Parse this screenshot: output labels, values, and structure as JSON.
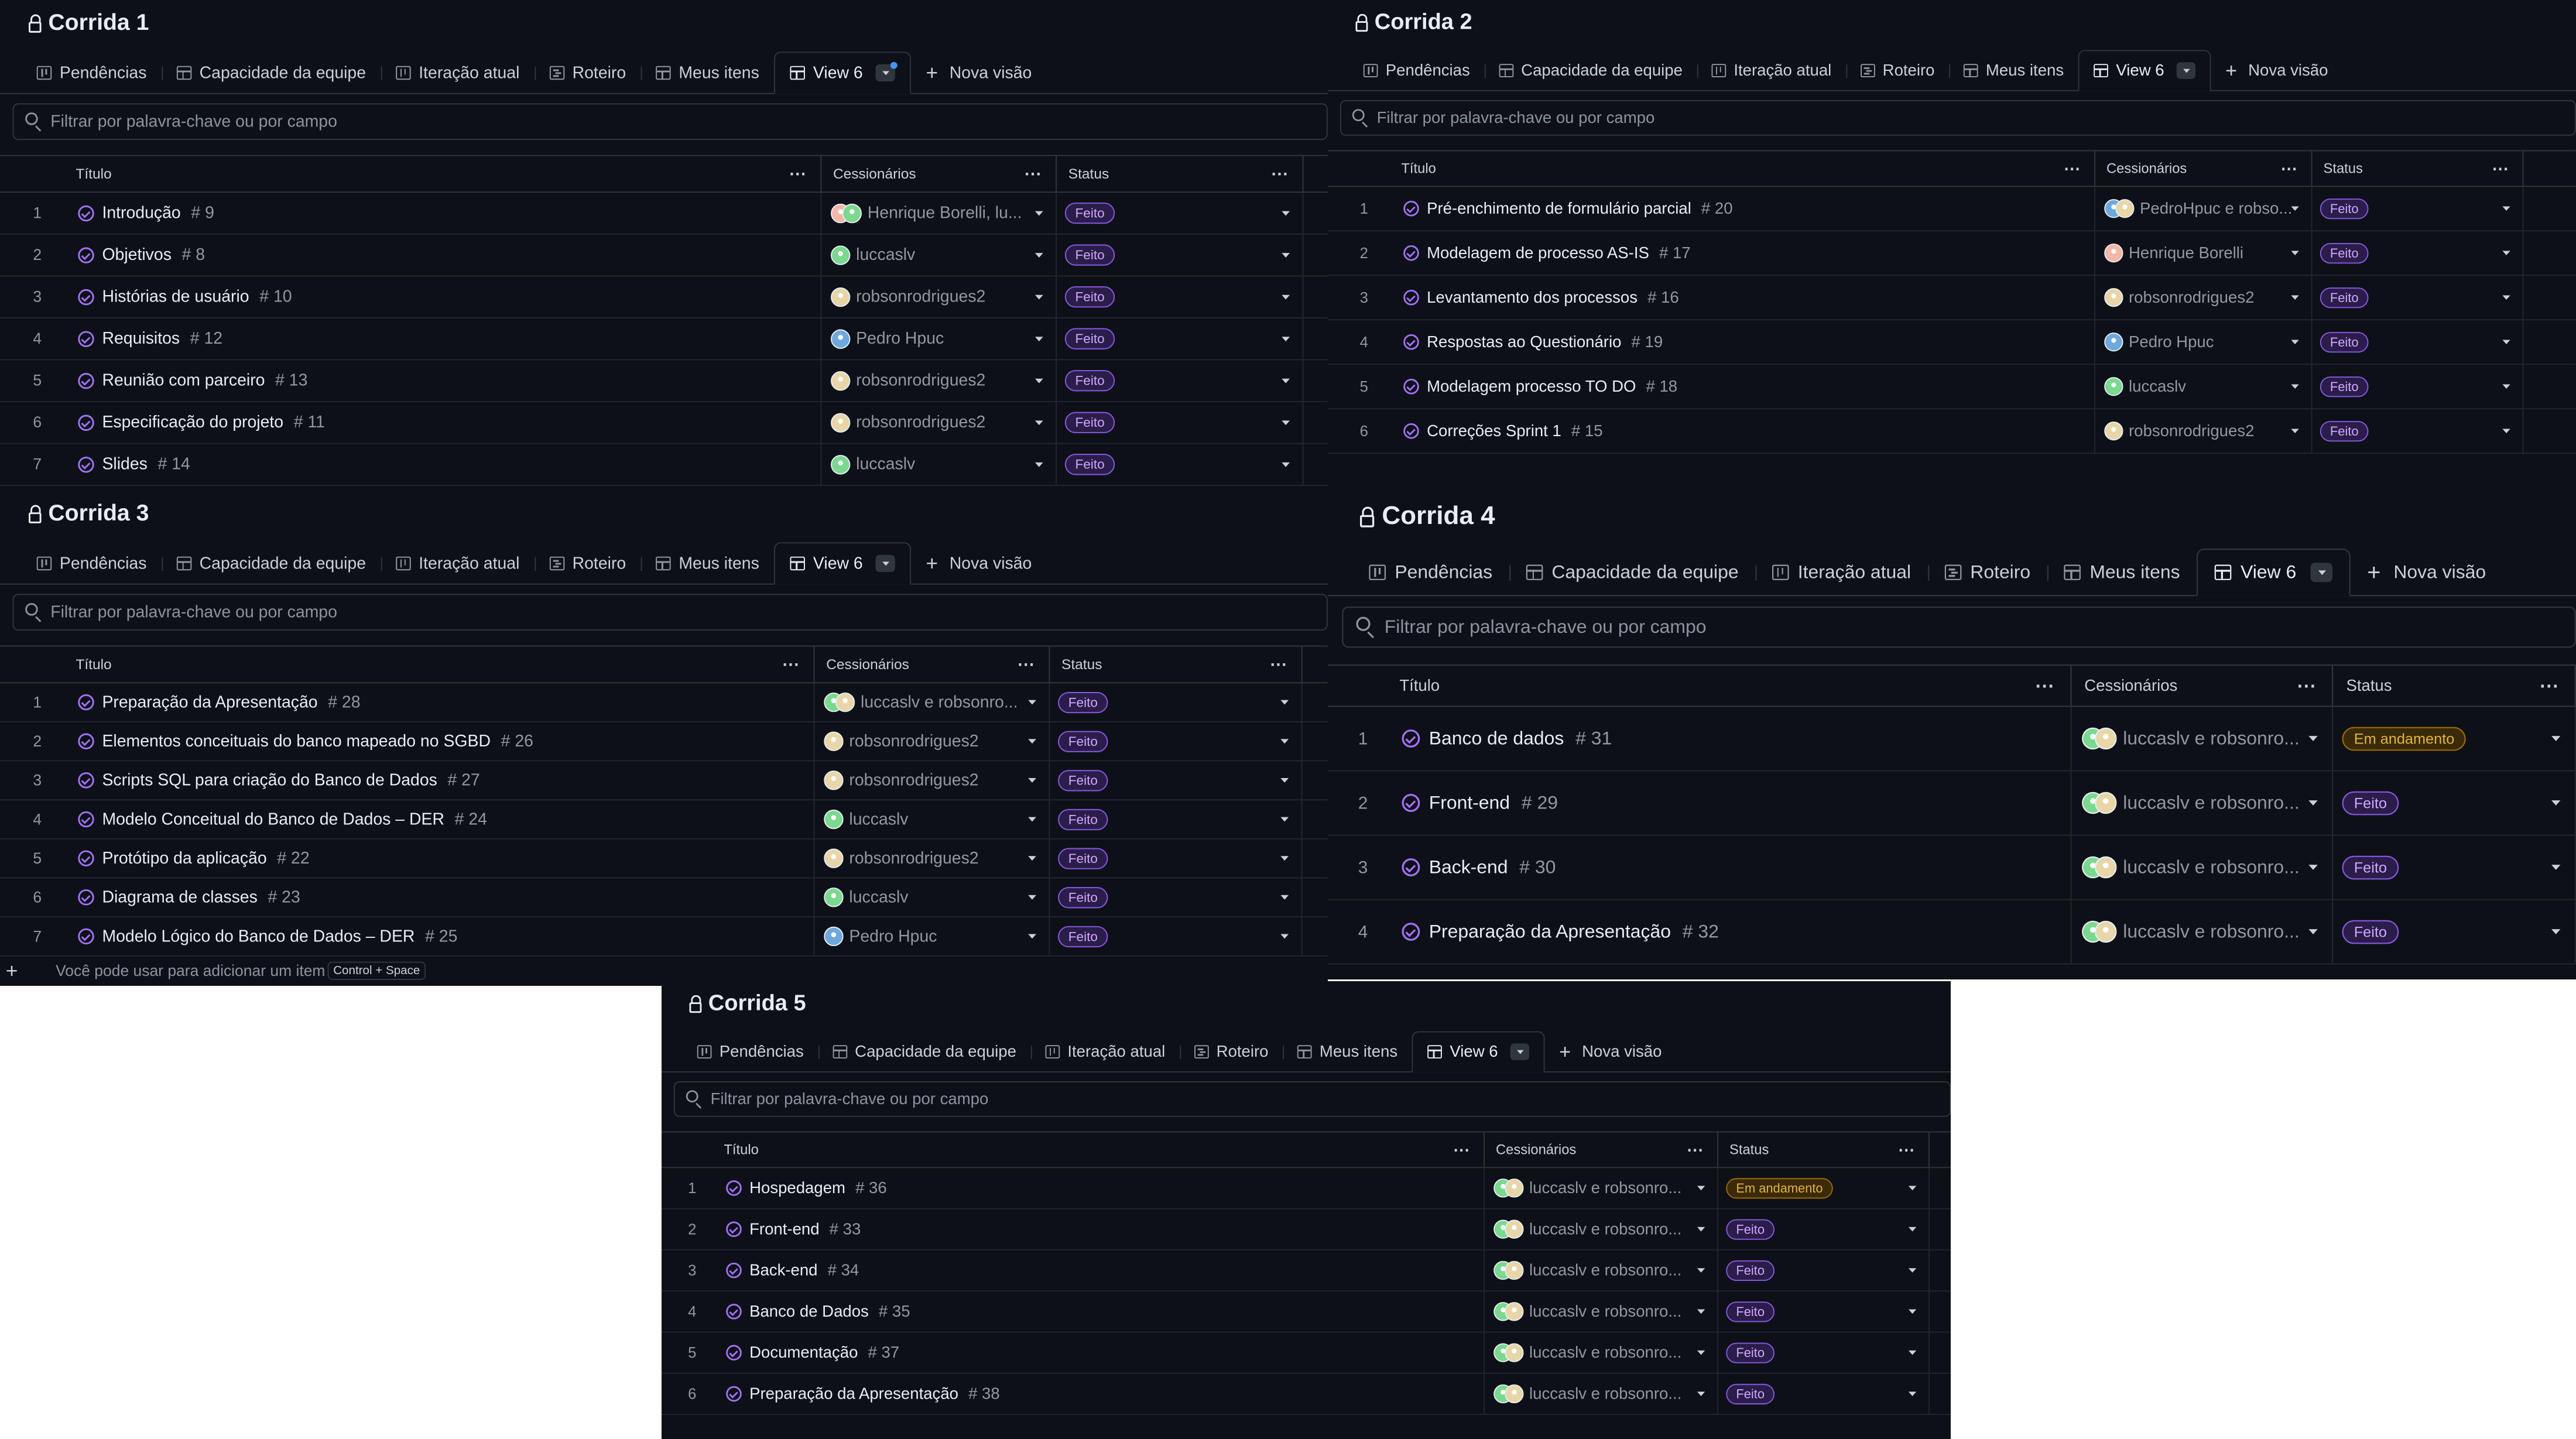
{
  "tabs": [
    {
      "label": "Pendências",
      "icon": "board-icon"
    },
    {
      "label": "Capacidade da equipe",
      "icon": "table-icon"
    },
    {
      "label": "Iteração atual",
      "icon": "board-icon"
    },
    {
      "label": "Roteiro",
      "icon": "roadmap-icon"
    },
    {
      "label": "Meus itens",
      "icon": "table-icon"
    },
    {
      "label": "View 6",
      "icon": "table-icon",
      "active": true
    }
  ],
  "new_view_label": "Nova visão",
  "filter_placeholder": "Filtrar por palavra-chave ou por campo",
  "columns": {
    "title": "Título",
    "assignees": "Cessionários",
    "status": "Status"
  },
  "add_item": {
    "text": "Você pode usar para adicionar um item",
    "shortcut": "Control + Space"
  },
  "colors": {
    "done_accent": "#a371f7",
    "progress_accent": "#e3b341",
    "background": "#0d1117"
  },
  "panels": [
    {
      "title": "Corrida 1",
      "rows": [
        {
          "n": "1",
          "title": "Introdução",
          "issue": "# 9",
          "assignee": "Henrique Borelli, lu...",
          "status": "Feito"
        },
        {
          "n": "2",
          "title": "Objetivos",
          "issue": "# 8",
          "assignee": "luccaslv",
          "status": "Feito"
        },
        {
          "n": "3",
          "title": "Histórias de usuário",
          "issue": "# 10",
          "assignee": "robsonrodrigues2",
          "status": "Feito"
        },
        {
          "n": "4",
          "title": "Requisitos",
          "issue": "# 12",
          "assignee": "Pedro Hpuc",
          "status": "Feito"
        },
        {
          "n": "5",
          "title": "Reunião com parceiro",
          "issue": "# 13",
          "assignee": "robsonrodrigues2",
          "status": "Feito"
        },
        {
          "n": "6",
          "title": "Especificação do projeto",
          "issue": "# 11",
          "assignee": "robsonrodrigues2",
          "status": "Feito"
        },
        {
          "n": "7",
          "title": "Slides",
          "issue": "# 14",
          "assignee": "luccaslv",
          "status": "Feito"
        }
      ]
    },
    {
      "title": "Corrida 2",
      "rows": [
        {
          "n": "1",
          "title": "Pré-enchimento de formulário parcial",
          "issue": "# 20",
          "assignee": "PedroHpuc e robso...",
          "status": "Feito"
        },
        {
          "n": "2",
          "title": "Modelagem de processo AS-IS",
          "issue": "# 17",
          "assignee": "Henrique Borelli",
          "status": "Feito"
        },
        {
          "n": "3",
          "title": "Levantamento dos processos",
          "issue": "# 16",
          "assignee": "robsonrodrigues2",
          "status": "Feito"
        },
        {
          "n": "4",
          "title": "Respostas ao Questionário",
          "issue": "# 19",
          "assignee": "Pedro Hpuc",
          "status": "Feito"
        },
        {
          "n": "5",
          "title": "Modelagem processo TO DO",
          "issue": "# 18",
          "assignee": "luccaslv",
          "status": "Feito"
        },
        {
          "n": "6",
          "title": "Correções Sprint 1",
          "issue": "# 15",
          "assignee": "robsonrodrigues2",
          "status": "Feito"
        }
      ]
    },
    {
      "title": "Corrida 3",
      "rows": [
        {
          "n": "1",
          "title": "Preparação da Apresentação",
          "issue": "# 28",
          "assignee": "luccaslv e robsonro...",
          "status": "Feito"
        },
        {
          "n": "2",
          "title": "Elementos conceituais do banco mapeado no SGBD",
          "issue": "# 26",
          "assignee": "robsonrodrigues2",
          "status": "Feito"
        },
        {
          "n": "3",
          "title": "Scripts SQL para criação do Banco de Dados",
          "issue": "# 27",
          "assignee": "robsonrodrigues2",
          "status": "Feito"
        },
        {
          "n": "4",
          "title": "Modelo Conceitual do Banco de Dados – DER",
          "issue": "# 24",
          "assignee": "luccaslv",
          "status": "Feito"
        },
        {
          "n": "5",
          "title": "Protótipo da aplicação",
          "issue": "# 22",
          "assignee": "robsonrodrigues2",
          "status": "Feito"
        },
        {
          "n": "6",
          "title": "Diagrama de classes",
          "issue": "# 23",
          "assignee": "luccaslv",
          "status": "Feito"
        },
        {
          "n": "7",
          "title": "Modelo Lógico do Banco de Dados – DER",
          "issue": "# 25",
          "assignee": "Pedro Hpuc",
          "status": "Feito"
        }
      ]
    },
    {
      "title": "Corrida 4",
      "rows": [
        {
          "n": "1",
          "title": "Banco de dados",
          "issue": "# 31",
          "assignee": "luccaslv e robsonro...",
          "status": "Em andamento"
        },
        {
          "n": "2",
          "title": "Front-end",
          "issue": "# 29",
          "assignee": "luccaslv e robsonro...",
          "status": "Feito"
        },
        {
          "n": "3",
          "title": "Back-end",
          "issue": "# 30",
          "assignee": "luccaslv e robsonro...",
          "status": "Feito"
        },
        {
          "n": "4",
          "title": "Preparação da Apresentação",
          "issue": "# 32",
          "assignee": "luccaslv e robsonro...",
          "status": "Feito"
        }
      ]
    },
    {
      "title": "Corrida 5",
      "rows": [
        {
          "n": "1",
          "title": "Hospedagem",
          "issue": "# 36",
          "assignee": "luccaslv e robsonro...",
          "status": "Em andamento"
        },
        {
          "n": "2",
          "title": "Front-end",
          "issue": "# 33",
          "assignee": "luccaslv e robsonro...",
          "status": "Feito"
        },
        {
          "n": "3",
          "title": "Back-end",
          "issue": "# 34",
          "assignee": "luccaslv e robsonro...",
          "status": "Feito"
        },
        {
          "n": "4",
          "title": "Banco de Dados",
          "issue": "# 35",
          "assignee": "luccaslv e robsonro...",
          "status": "Feito"
        },
        {
          "n": "5",
          "title": "Documentação",
          "issue": "# 37",
          "assignee": "luccaslv e robsonro...",
          "status": "Feito"
        },
        {
          "n": "6",
          "title": "Preparação da Apresentação",
          "issue": "# 38",
          "assignee": "luccaslv e robsonro...",
          "status": "Feito"
        }
      ]
    }
  ]
}
